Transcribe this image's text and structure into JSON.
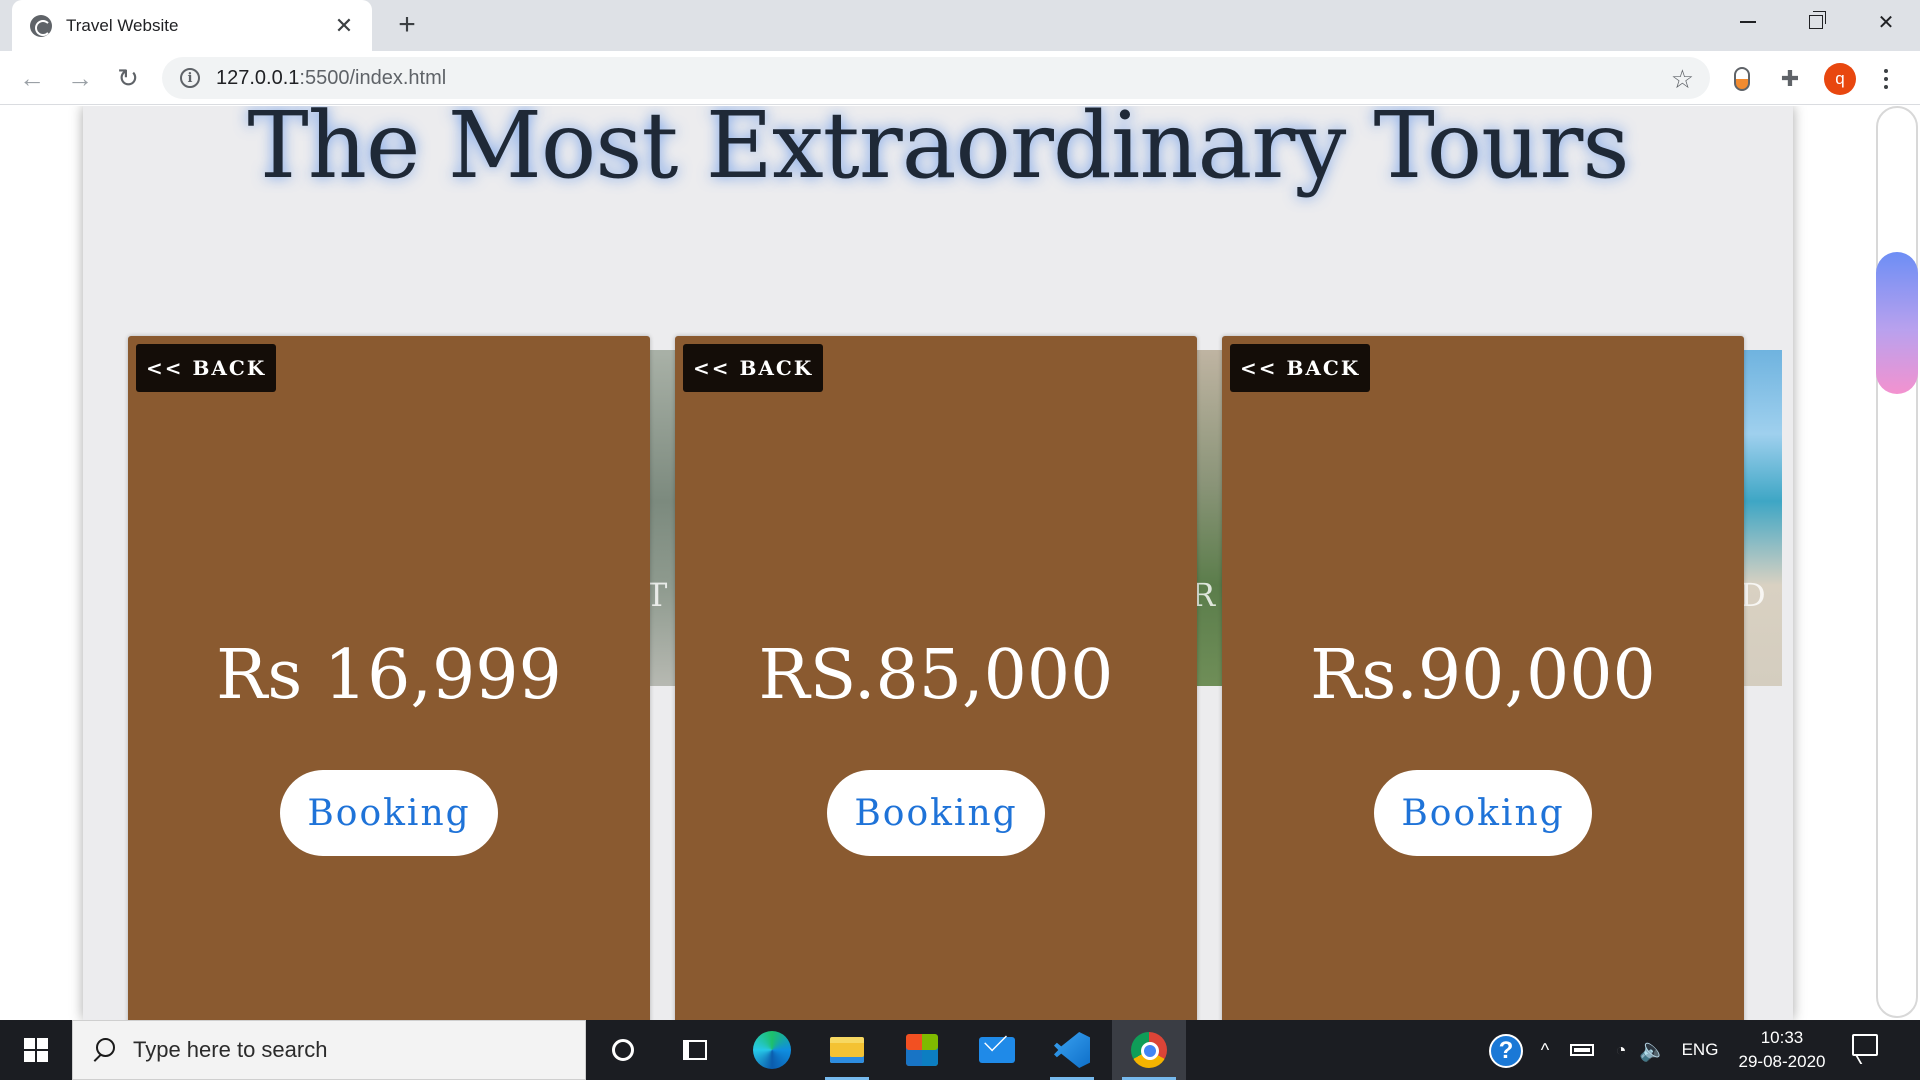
{
  "browser": {
    "tab_title": "Travel Website",
    "url_host": "127.0.0.1",
    "url_path": ":5500/index.html",
    "profile_initial": "q"
  },
  "page": {
    "heading": "The Most Extraordinary Tours",
    "cards": [
      {
        "back_label": "<< BACK",
        "price": "Rs 16,999",
        "button": "Booking"
      },
      {
        "back_label": "<< BACK",
        "price": "RS.85,000",
        "button": "Booking"
      },
      {
        "back_label": "<< BACK",
        "price": "Rs.90,000",
        "button": "Booking"
      }
    ],
    "strip_glyphs": [
      "T",
      "R",
      "D"
    ]
  },
  "taskbar": {
    "search_placeholder": "Type here to search",
    "language": "ENG",
    "time": "10:33",
    "date": "29-08-2020"
  },
  "colors": {
    "card_bg": "#8a5a30",
    "booking_text": "#1f73d8",
    "heading_glow": "#4682e6"
  }
}
